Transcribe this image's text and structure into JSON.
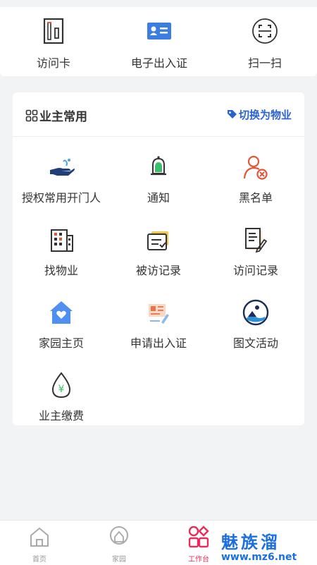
{
  "top_actions": [
    {
      "label": "访问卡",
      "icon": "door-card-icon"
    },
    {
      "label": "电子出入证",
      "icon": "id-card-icon"
    },
    {
      "label": "扫一扫",
      "icon": "scan-icon"
    }
  ],
  "section": {
    "title": "业主常用",
    "switch_label": "切换为物业"
  },
  "grid": [
    {
      "label": "授权常用开门人",
      "icon": "hand-authorize-icon"
    },
    {
      "label": "通知",
      "icon": "bell-icon"
    },
    {
      "label": "黑名单",
      "icon": "blacklist-user-icon"
    },
    {
      "label": "找物业",
      "icon": "building-icon"
    },
    {
      "label": "被访记录",
      "icon": "visited-record-icon"
    },
    {
      "label": "访问记录",
      "icon": "visit-record-icon"
    },
    {
      "label": "家园主页",
      "icon": "home-icon"
    },
    {
      "label": "申请出入证",
      "icon": "apply-pass-icon"
    },
    {
      "label": "图文活动",
      "icon": "picture-activity-icon"
    },
    {
      "label": "业主缴费",
      "icon": "payment-drop-icon"
    }
  ],
  "tabbar": [
    {
      "label": "首页",
      "icon": "home-tab-icon",
      "active": false
    },
    {
      "label": "家园",
      "icon": "community-tab-icon",
      "active": false
    },
    {
      "label": "工作台",
      "icon": "workbench-tab-icon",
      "active": true
    }
  ],
  "watermark": {
    "main": "魅族溜",
    "url": "www.mz6.net"
  },
  "colors": {
    "accent_blue": "#2a62d6",
    "active_tab": "#e62e5c",
    "background": "#f2f3f5"
  }
}
